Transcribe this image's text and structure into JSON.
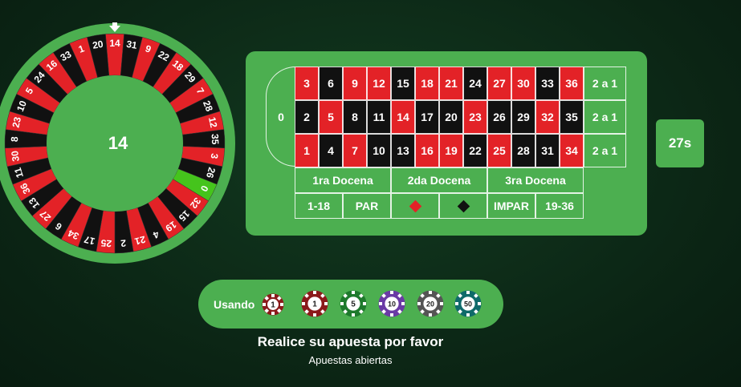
{
  "wheel": {
    "result": "14",
    "order": [
      14,
      31,
      9,
      22,
      18,
      29,
      7,
      28,
      12,
      35,
      3,
      26,
      0,
      32,
      15,
      19,
      4,
      21,
      2,
      25,
      17,
      34,
      6,
      27,
      13,
      36,
      11,
      30,
      8,
      23,
      10,
      5,
      24,
      16,
      33,
      1,
      20
    ],
    "red_numbers": [
      1,
      3,
      5,
      7,
      9,
      12,
      14,
      16,
      18,
      19,
      21,
      23,
      25,
      27,
      30,
      32,
      34,
      36
    ],
    "colors": {
      "red": "#e32227",
      "black": "#111111",
      "green": "#45c41c",
      "rim": "#4caf50"
    }
  },
  "table": {
    "zero": "0",
    "rows": [
      [
        "3",
        "6",
        "9",
        "12",
        "15",
        "18",
        "21",
        "24",
        "27",
        "30",
        "33",
        "36"
      ],
      [
        "2",
        "5",
        "8",
        "11",
        "14",
        "17",
        "20",
        "23",
        "26",
        "29",
        "32",
        "35"
      ],
      [
        "1",
        "4",
        "7",
        "10",
        "13",
        "16",
        "19",
        "22",
        "25",
        "28",
        "31",
        "34"
      ]
    ],
    "columns": [
      "2 a 1",
      "2 a 1",
      "2 a 1"
    ],
    "dozens": [
      "1ra Docena",
      "2da Docena",
      "3ra Docena"
    ],
    "outside": [
      "1-18",
      "PAR",
      "IMPAR",
      "19-36"
    ]
  },
  "timer": "27s",
  "chips": {
    "using_label": "Usando",
    "selected": "1",
    "options": [
      {
        "value": "1",
        "color": "#8b1a1a"
      },
      {
        "value": "5",
        "color": "#1e7a2c"
      },
      {
        "value": "10",
        "color": "#6a3aa5"
      },
      {
        "value": "20",
        "color": "#555555"
      },
      {
        "value": "50",
        "color": "#0f6a6a"
      }
    ]
  },
  "status": {
    "main": "Realice su apuesta por favor",
    "sub": "Apuestas abiertas"
  }
}
